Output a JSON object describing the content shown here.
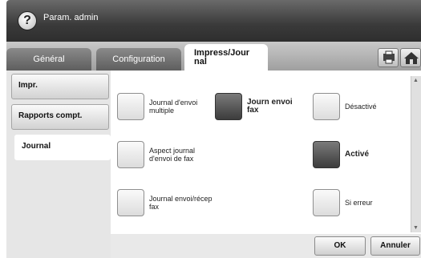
{
  "header": {
    "title": "Param. admin",
    "help_glyph": "?"
  },
  "tabs": [
    {
      "label": "Général",
      "active": false
    },
    {
      "label": "Configuration",
      "active": false
    },
    {
      "label": "Impress/Jour nal",
      "active": true
    }
  ],
  "header_icons": [
    "printer-job-icon",
    "home-icon"
  ],
  "sidebar": {
    "items": [
      {
        "label": "Impr.",
        "selected": false
      },
      {
        "label": "Rapports compt.",
        "selected": false
      },
      {
        "label": "Journal",
        "selected": true
      }
    ]
  },
  "options": {
    "multi": {
      "label": "Journal d'envoi multiple",
      "selected": false
    },
    "fax_log": {
      "label": "Journ envoi fax",
      "selected": true
    },
    "desactive": {
      "label": "Désactivé",
      "selected": false
    },
    "aspect": {
      "label": "Aspect journal d'envoi de fax",
      "selected": false
    },
    "active": {
      "label": "Activé",
      "selected": true
    },
    "envoi_recep": {
      "label": "Journal envoi/récep fax",
      "selected": false
    },
    "si_erreur": {
      "label": "Si erreur",
      "selected": false
    }
  },
  "footer": {
    "ok_label": "OK",
    "cancel_label": "Annuler"
  }
}
